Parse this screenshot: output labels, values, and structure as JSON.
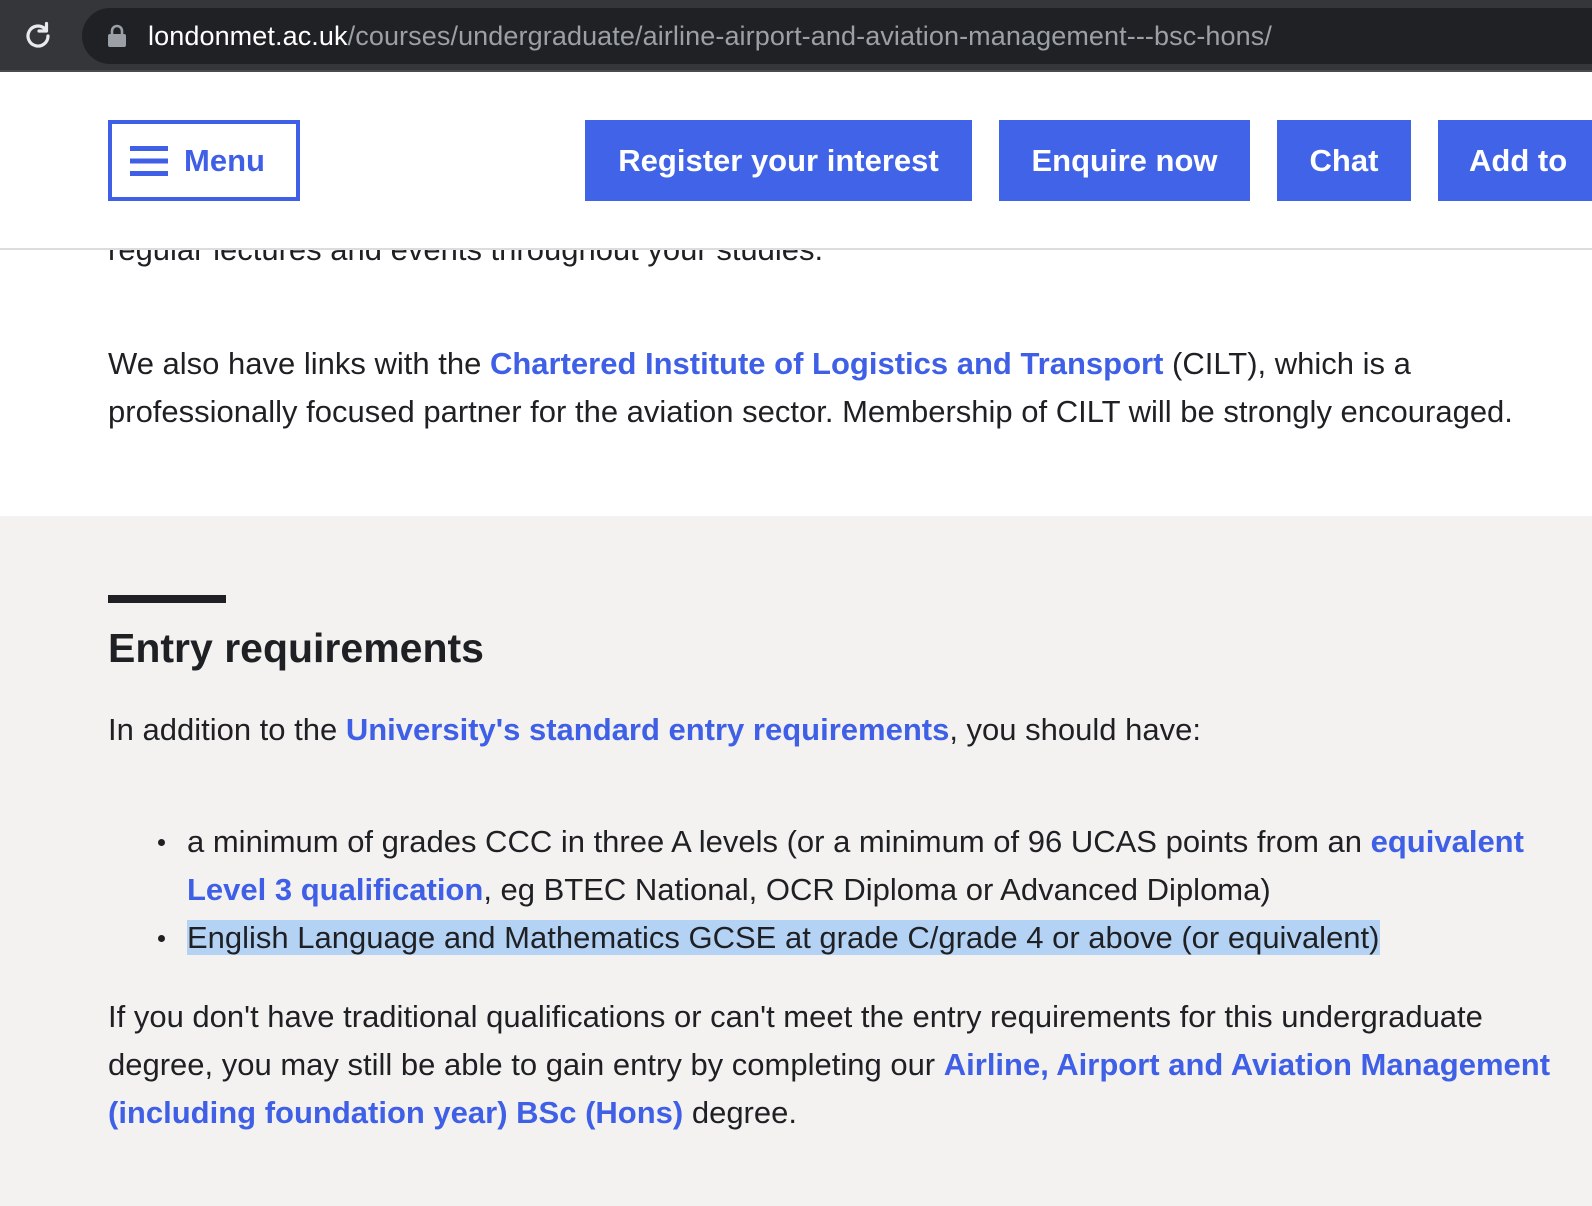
{
  "browser": {
    "url_host": "londonmet.ac.uk",
    "url_path": "/courses/undergraduate/airline-airport-and-aviation-management---bsc-hons/",
    "reload_icon": "reload-icon",
    "lock_icon": "lock-icon"
  },
  "header": {
    "menu_label": "Menu",
    "menu_icon": "hamburger-icon",
    "register_label": "Register your interest",
    "enquire_label": "Enquire now",
    "chat_label": "Chat",
    "add_label": "Add to"
  },
  "content": {
    "partial_line": "regular lectures and events throughout your studies.",
    "cilt": {
      "before": "We also have links with the ",
      "link": "Chartered Institute of Logistics and Transport",
      "after": " (CILT), which is a professionally focused partner for the aviation sector. Membership of CILT will be strongly encouraged."
    }
  },
  "entry": {
    "heading": "Entry requirements",
    "intro_before": "In addition to the ",
    "intro_link": "University's standard entry requirements",
    "intro_after": ", you should have:",
    "req1_before": "a minimum of grades CCC in three A levels (or a minimum of 96 UCAS points from an ",
    "req1_link": "equivalent Level 3 qualification",
    "req1_after": ", eg BTEC National, OCR Diploma or Advanced Diploma)",
    "req2": "English Language and Mathematics GCSE at grade C/grade 4 or above (or equivalent)",
    "foundation_before": "If you don't have traditional qualifications or can't meet the entry requirements for this undergraduate degree, you may still be able to gain entry by completing our ",
    "foundation_link": "Airline, Airport and Aviation Management (including foundation year) BSc (Hons)",
    "foundation_after": " degree."
  },
  "colors": {
    "accent": "#4063e8",
    "link": "#3f5fe6",
    "selection": "#b4d2f3",
    "grey_section": "#f3f2f1"
  }
}
